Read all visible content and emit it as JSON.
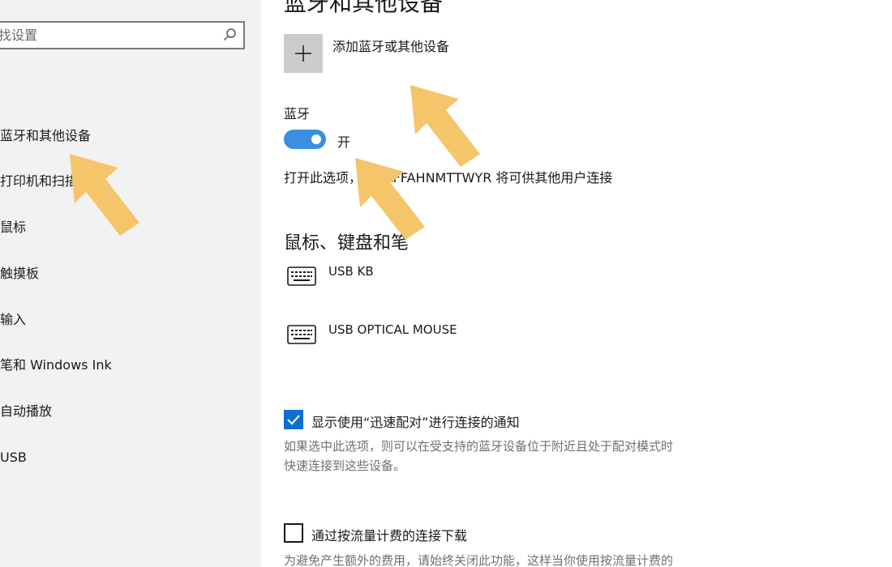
{
  "sidebar": {
    "search_placeholder": "找设置",
    "items": [
      {
        "label": "蓝牙和其他设备"
      },
      {
        "label": "打印机和扫描仪"
      },
      {
        "label": "鼠标"
      },
      {
        "label": "触摸板"
      },
      {
        "label": "输入"
      },
      {
        "label": "笔和 Windows Ink"
      },
      {
        "label": "自动播放"
      },
      {
        "label": "USB"
      }
    ]
  },
  "main": {
    "heading": "蓝牙和其他设备",
    "add_device_label": "添加蓝牙或其他设备",
    "bluetooth_label": "蓝牙",
    "bluetooth_state": "开",
    "discoverable_text": "打开此选项，MS-LFFAHNMTTWYR 将可供其他用户连接",
    "section_heading": "鼠标、键盘和笔",
    "devices": [
      {
        "name": "USB KB",
        "icon": "keyboard-icon"
      },
      {
        "name": "USB OPTICAL MOUSE",
        "icon": "keyboard-icon"
      }
    ],
    "swift_pair_label": "显示使用“迅速配对”进行连接的通知",
    "swift_pair_checked": true,
    "swift_pair_desc_1": "如果选中此选项，则可以在受支持的蓝牙设备位于附近且处于配对模式时",
    "swift_pair_desc_2": "快速连接到这些设备。",
    "metered_label": "通过按流量计费的连接下载",
    "metered_checked": false,
    "metered_desc": "为避免产生额外的费用，请始终关闭此功能，这样当你使用按流量计费的"
  },
  "colors": {
    "accent": "#0f6fd0",
    "toggle_on": "#3a8fe0",
    "arrow": "#f5c56a",
    "sidebar_bg": "#f2f2f2"
  }
}
